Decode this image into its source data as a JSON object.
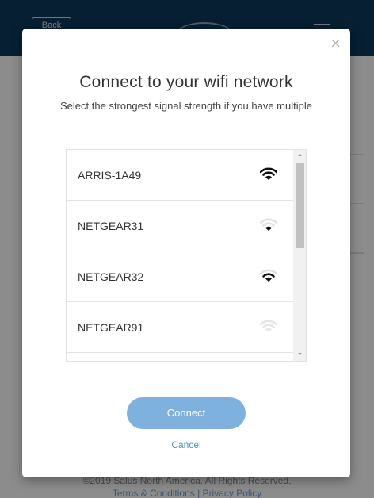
{
  "background": {
    "back_label": "Back",
    "footer_copyright": "©2019   Salus North America. All Rights Reserved.",
    "footer_links": "Terms & Conditions   |   Privacy Policy"
  },
  "modal": {
    "close_glyph": "×",
    "title": "Connect to your wifi network",
    "subtitle": "Select the strongest signal strength if you have multiple",
    "networks": [
      {
        "name": "ARRIS-1A49",
        "signal": "full",
        "icon": "wifi-strong-icon"
      },
      {
        "name": "NETGEAR31",
        "signal": "weak",
        "icon": "wifi-weak-icon"
      },
      {
        "name": "NETGEAR32",
        "signal": "good",
        "icon": "wifi-good-icon"
      },
      {
        "name": "NETGEAR91",
        "signal": "faint",
        "icon": "wifi-faint-icon"
      }
    ],
    "connect_label": "Connect",
    "cancel_label": "Cancel"
  },
  "colors": {
    "header": "#0b3a5c",
    "button": "#7fb1de",
    "link": "#4a90d9"
  }
}
